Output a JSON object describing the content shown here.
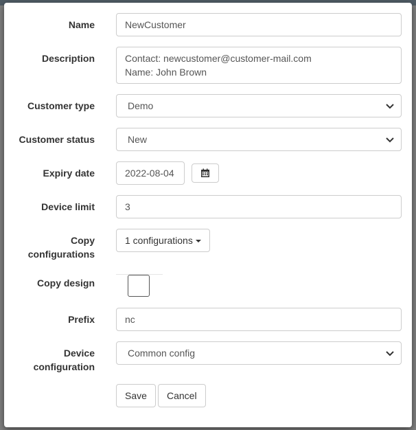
{
  "form": {
    "name": {
      "label": "Name",
      "value": "NewCustomer"
    },
    "description": {
      "label": "Description",
      "value": "Contact: newcustomer@customer-mail.com\nName: John Brown"
    },
    "customer_type": {
      "label": "Customer type",
      "value": "Demo"
    },
    "customer_status": {
      "label": "Customer status",
      "value": "New"
    },
    "expiry_date": {
      "label": "Expiry date",
      "value": "2022-08-04",
      "button_icon": "calendar-icon"
    },
    "device_limit": {
      "label": "Device limit",
      "value": "3"
    },
    "copy_configurations": {
      "label": "Copy configurations",
      "button": "1 configurations"
    },
    "copy_design": {
      "label": "Copy design",
      "checked": false
    },
    "prefix": {
      "label": "Prefix",
      "value": "nc"
    },
    "device_configuration": {
      "label": "Device configuration",
      "value": "Common config"
    }
  },
  "actions": {
    "save": "Save",
    "cancel": "Cancel"
  },
  "colors": {
    "overlay": "#7f7f7f",
    "border": "#cccccc",
    "label": "#333333",
    "text": "#555555"
  }
}
